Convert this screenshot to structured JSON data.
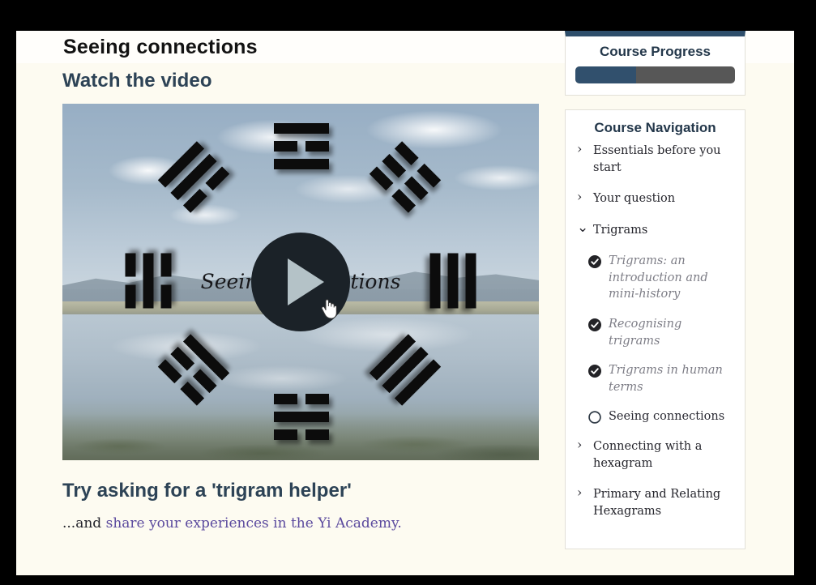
{
  "page": {
    "title": "Seeing connections",
    "background_color": "#fdfbf1"
  },
  "main": {
    "watch_heading": "Watch the video",
    "video": {
      "caption": "Seeing connections",
      "play_icon": "play-icon",
      "cursor_icon": "hand-pointer-cursor",
      "trigram_positions": [
        {
          "name": "top",
          "lines": [
            "yang",
            "yin",
            "yang"
          ]
        },
        {
          "name": "top-left",
          "lines": [
            "yang",
            "yang",
            "yin"
          ]
        },
        {
          "name": "top-right",
          "lines": [
            "yin",
            "yin",
            "yin"
          ]
        },
        {
          "name": "left",
          "lines": [
            "yin",
            "yang",
            "yin"
          ]
        },
        {
          "name": "right",
          "lines": [
            "yang",
            "yang",
            "yang"
          ]
        },
        {
          "name": "bottom-left",
          "lines": [
            "yin",
            "yin",
            "yang"
          ]
        },
        {
          "name": "bottom-right",
          "lines": [
            "yang",
            "yang",
            "yang"
          ]
        },
        {
          "name": "bottom",
          "lines": [
            "yin",
            "yang",
            "yin"
          ]
        }
      ]
    },
    "cta_heading": "Try asking for a 'trigram helper'",
    "cta_prefix": "...and ",
    "cta_link": "share your experiences in the Yi Academy.",
    "link_color": "#5b4a9e"
  },
  "sidebar": {
    "progress": {
      "title": "Course Progress",
      "percent": 38,
      "fill_color": "#31506d",
      "track_color": "#575757",
      "accent_color": "#2e4e6b"
    },
    "navigation": {
      "title": "Course Navigation",
      "items": [
        {
          "label": "Essentials before you start",
          "icon": "chevron-right-icon",
          "type": "group",
          "state": "collapsed"
        },
        {
          "label": "Your question",
          "icon": "chevron-right-icon",
          "type": "group",
          "state": "collapsed"
        },
        {
          "label": "Trigrams",
          "icon": "chevron-down-icon",
          "type": "group",
          "state": "expanded"
        },
        {
          "label": "Trigrams: an introduction and mini-history",
          "icon": "check-circle-icon",
          "type": "lesson",
          "state": "completed"
        },
        {
          "label": "Recognising trigrams",
          "icon": "check-circle-icon",
          "type": "lesson",
          "state": "completed"
        },
        {
          "label": "Trigrams in human terms",
          "icon": "check-circle-icon",
          "type": "lesson",
          "state": "completed"
        },
        {
          "label": "Seeing connections",
          "icon": "empty-circle-icon",
          "type": "lesson",
          "state": "current"
        },
        {
          "label": "Connecting with a hexagram",
          "icon": "chevron-right-icon",
          "type": "group",
          "state": "collapsed"
        },
        {
          "label": "Primary and Relating Hexagrams",
          "icon": "chevron-right-icon",
          "type": "group",
          "state": "collapsed"
        }
      ]
    }
  }
}
